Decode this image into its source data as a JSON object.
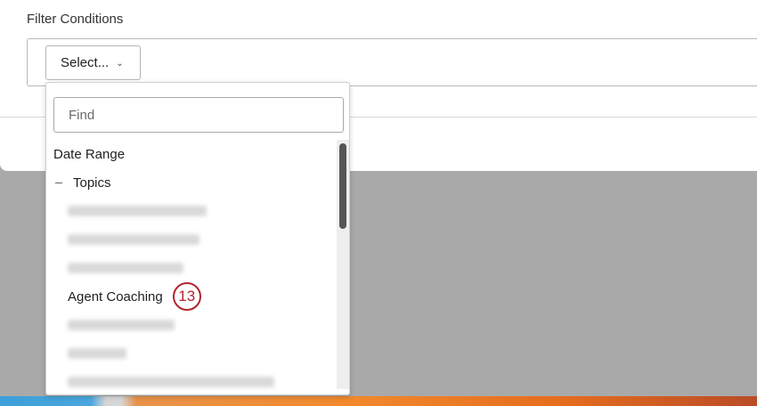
{
  "filter": {
    "label": "Filter Conditions",
    "select_label": "Select...",
    "select_chevron": "⌄"
  },
  "dropdown": {
    "find_placeholder": "Find",
    "items": {
      "date_range": "Date Range",
      "topics": "Topics",
      "agent_coaching": "Agent Coaching"
    }
  },
  "callout": {
    "number": "13",
    "color": "#b3242e"
  },
  "icons": {
    "collapse": "minus-icon",
    "chevron": "chevron-down-icon"
  }
}
